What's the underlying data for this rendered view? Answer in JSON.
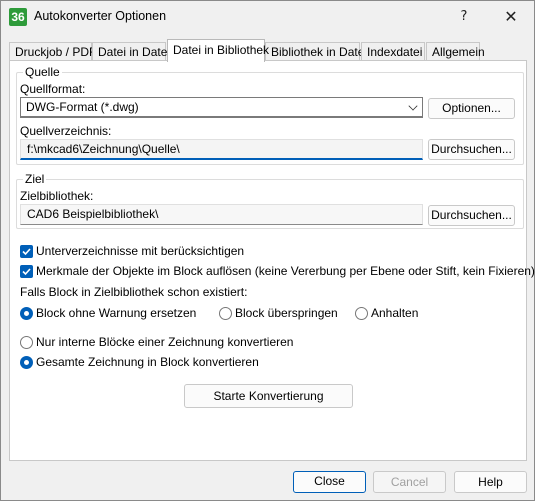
{
  "window": {
    "title": "Autokonverter Optionen",
    "icon_text": "36",
    "help_glyph": "?",
    "close_glyph": "✕"
  },
  "tabs": [
    "Druckjob / PDF",
    "Datei in Datei",
    "Datei in Bibliothek",
    "Bibliothek in Datei",
    "Indexdatei",
    "Allgemein"
  ],
  "active_tab": "Datei in Bibliothek",
  "quelle": {
    "group_title": "Quelle",
    "format_label": "Quellformat:",
    "format_value": "DWG-Format (*.dwg)",
    "options_button": "Optionen...",
    "dir_label": "Quellverzeichnis:",
    "dir_value": "f:\\mkcad6\\Zeichnung\\Quelle\\",
    "browse_button": "Durchsuchen..."
  },
  "ziel": {
    "group_title": "Ziel",
    "lib_label": "Zielbibliothek:",
    "lib_value": "CAD6 Beispielbibliothek\\",
    "browse_button": "Durchsuchen..."
  },
  "options": {
    "check_subdirs": "Unterverzeichnisse mit berücksichtigen",
    "check_resolve": "Merkmale der Objekte im Block auflösen (keine Vererbung per Ebene oder Stift, kein Fixieren)",
    "exists_label": "Falls Block in Zielbibliothek schon existiert:",
    "radio_replace": "Block ohne Warnung ersetzen",
    "radio_skip": "Block überspringen",
    "radio_stop": "Anhalten",
    "radio_internal": "Nur interne Blöcke einer Zeichnung konvertieren",
    "radio_whole": "Gesamte Zeichnung in Block konvertieren"
  },
  "start_button": "Starte Konvertierung",
  "footer": {
    "close": "Close",
    "cancel": "Cancel",
    "help": "Help"
  },
  "colors": {
    "accent": "#005fb8",
    "app_icon": "#2e9b3a"
  }
}
